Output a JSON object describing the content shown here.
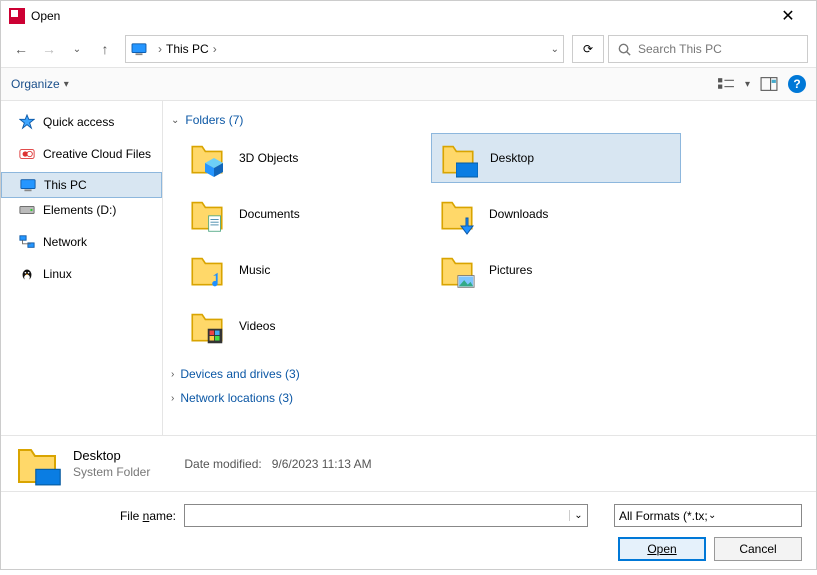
{
  "window": {
    "title": "Open",
    "close_glyph": "✕"
  },
  "nav": {
    "back": "←",
    "fwd": "→",
    "recent_dd": "⌄",
    "up": "↑",
    "crumb_label": "This PC",
    "crumb_sep": "›",
    "crumb_dd": "⌄",
    "refresh": "⟳",
    "search_placeholder": "Search This PC"
  },
  "toolbar": {
    "organize": "Organize",
    "organize_dd": "▾",
    "help": "?"
  },
  "sidebar": {
    "items": [
      {
        "label": "Quick access",
        "icon": "star"
      },
      {
        "label": "Creative Cloud Files",
        "icon": "cc"
      },
      {
        "label": "This PC",
        "icon": "pc",
        "selected": true
      },
      {
        "label": "Elements (D:)",
        "icon": "drive"
      },
      {
        "label": "Network",
        "icon": "net"
      },
      {
        "label": "Linux",
        "icon": "linux"
      }
    ]
  },
  "groups": {
    "folders_label": "Folders (7)",
    "devices_label": "Devices and drives (3)",
    "network_label": "Network locations (3)",
    "chev_open": "⌄",
    "chev_closed": "›"
  },
  "folders": [
    {
      "label": "3D Objects",
      "icon": "3d"
    },
    {
      "label": "Desktop",
      "icon": "desktop",
      "selected": true
    },
    {
      "label": "Documents",
      "icon": "docs"
    },
    {
      "label": "Downloads",
      "icon": "dl"
    },
    {
      "label": "Music",
      "icon": "music"
    },
    {
      "label": "Pictures",
      "icon": "pics"
    },
    {
      "label": "Videos",
      "icon": "vids"
    }
  ],
  "detail": {
    "name": "Desktop",
    "type": "System Folder",
    "mod_label": "Date modified:",
    "mod_value": "9/6/2023 11:13 AM"
  },
  "bottom": {
    "file_label": "File name:",
    "file_value": "",
    "filter": "All Formats (*.tx;*.rtf;*.htm;*.ht",
    "open": "Open",
    "cancel": "Cancel",
    "dd": "⌄"
  }
}
